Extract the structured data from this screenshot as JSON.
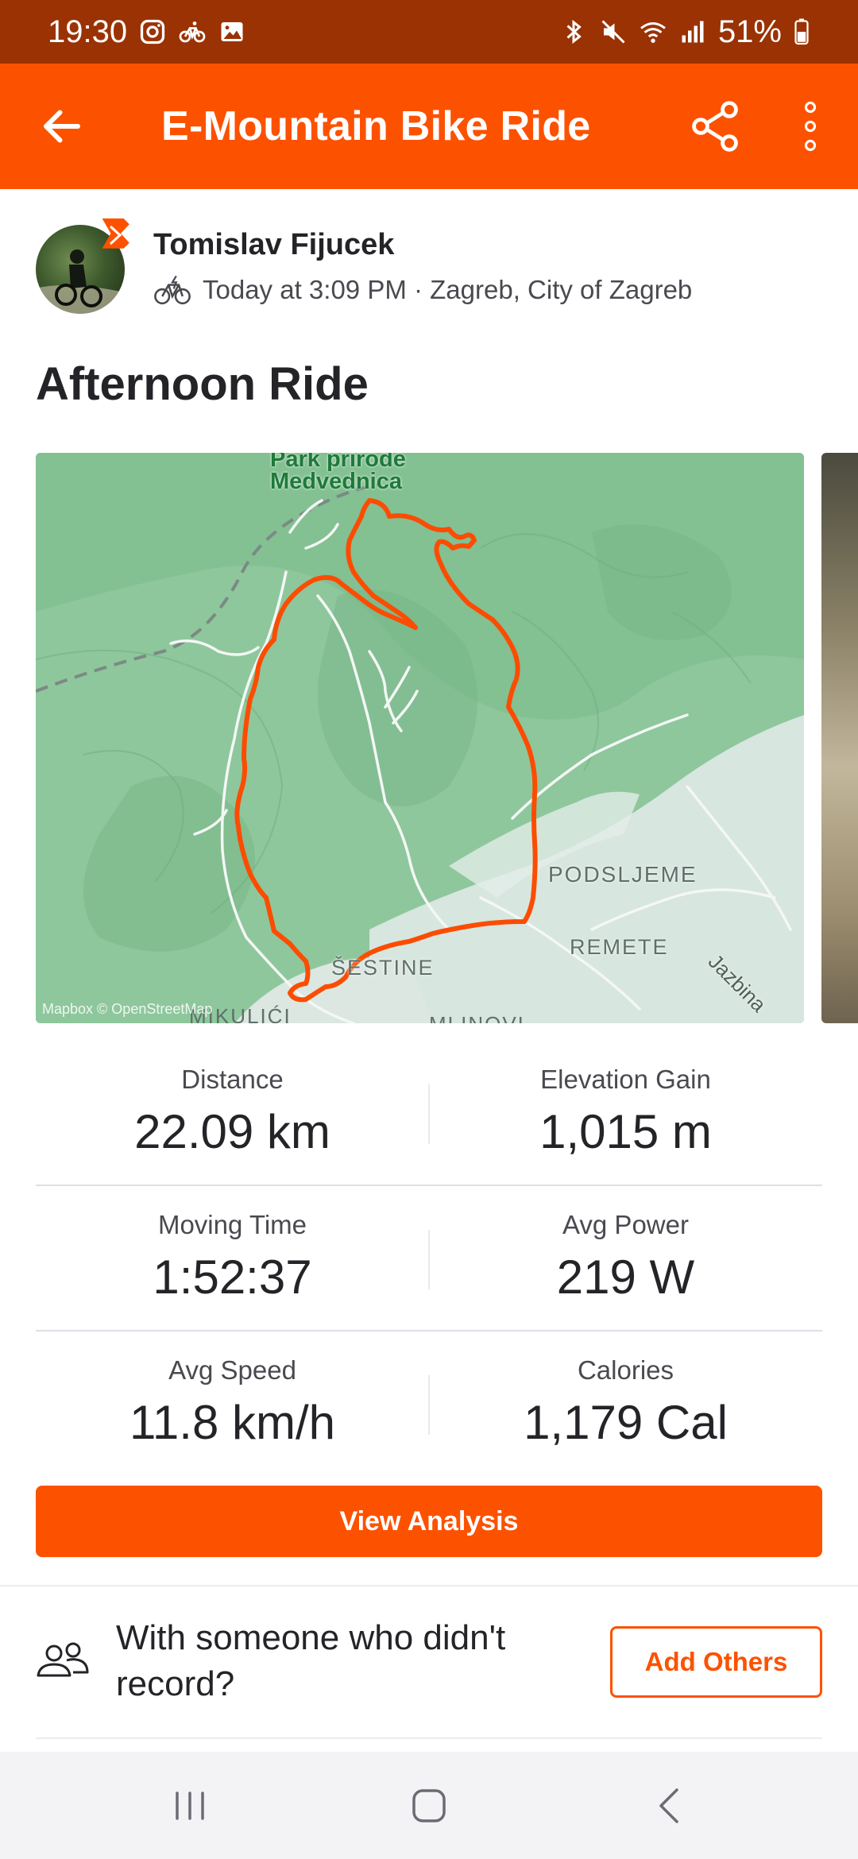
{
  "status_bar": {
    "time": "19:30",
    "battery": "51%",
    "left_icons": [
      "instagram-icon",
      "bicycle-notification-icon",
      "gallery-icon"
    ],
    "right_icons": [
      "bluetooth-icon",
      "mute-icon",
      "wifi-icon",
      "signal-icon",
      "battery-icon"
    ]
  },
  "app_bar": {
    "title": "E-Mountain Bike Ride",
    "back_icon": "arrow-left-icon",
    "share_icon": "share-icon",
    "more_icon": "more-vert-icon"
  },
  "athlete": {
    "name": "Tomislav Fijucek",
    "meta": "Today at 3:09 PM · Zagreb, City of Zagreb",
    "sport_icon": "ebike-icon"
  },
  "activity": {
    "title": "Afternoon Ride"
  },
  "map": {
    "labels": {
      "park": "Park prirode",
      "park2": "Medvednica",
      "podsljeme": "PODSLJEME",
      "remete": "REMETE",
      "jazbina": "Jazbina",
      "sestine": "ŠESTINE",
      "mikulici": "MIKULIĆI",
      "mlinovi": "MLINOVI",
      "attribution": "Mapbox © OpenStreetMap"
    },
    "colors": {
      "terrain": "#8ec79c",
      "route": "#fc4c02",
      "road": "#ffffff"
    }
  },
  "stats": [
    {
      "label": "Distance",
      "value": "22.09 km"
    },
    {
      "label": "Elevation Gain",
      "value": "1,015 m"
    },
    {
      "label": "Moving Time",
      "value": "1:52:37"
    },
    {
      "label": "Avg Power",
      "value": "219 W"
    },
    {
      "label": "Avg Speed",
      "value": "11.8 km/h"
    },
    {
      "label": "Calories",
      "value": "1,179 Cal"
    }
  ],
  "actions": {
    "view_analysis": "View Analysis",
    "others_prompt": "With someone who didn't record?",
    "add_others": "Add Others"
  },
  "theme": {
    "brand": "#fc5200",
    "status_bar": "#9a3203"
  }
}
